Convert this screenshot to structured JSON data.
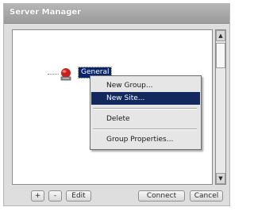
{
  "window": {
    "title": "Server Manager"
  },
  "tree": {
    "items": [
      {
        "label": "General",
        "icon": "server-icon",
        "selected": true
      }
    ]
  },
  "context_menu": {
    "items": [
      {
        "label": "New Group...",
        "selected": false
      },
      {
        "label": "New Site...",
        "selected": true
      },
      {
        "label": "Delete",
        "selected": false
      },
      {
        "label": "Group Properties...",
        "selected": false
      }
    ]
  },
  "scrollbar": {
    "up_icon": "scroll-up-arrow-icon",
    "down_icon": "scroll-down-arrow-icon"
  },
  "buttons": {
    "add": "+",
    "remove": "-",
    "edit": "Edit",
    "connect": "Connect",
    "cancel": "Cancel"
  },
  "colors": {
    "selection": "#0a2469",
    "menu_selection": "#13285e",
    "title_bar": "#a9a9a9",
    "dialog_bg": "#dedede"
  }
}
